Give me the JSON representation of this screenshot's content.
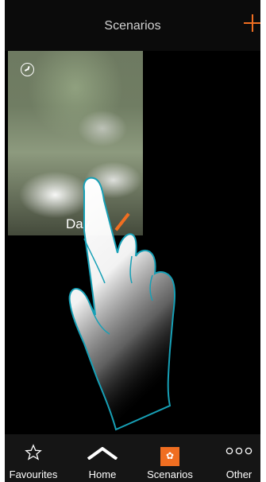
{
  "header": {
    "title": "Scenarios",
    "add_icon": "plus-icon"
  },
  "scenarios": [
    {
      "label": "Day",
      "icon": "clock-icon",
      "edit_icon": "pencil-icon"
    }
  ],
  "nav": {
    "items": [
      {
        "label": "Favourites",
        "icon": "star-icon",
        "active": false
      },
      {
        "label": "Home",
        "icon": "home-icon",
        "active": false
      },
      {
        "label": "Scenarios",
        "icon": "scenario-icon",
        "active": true
      },
      {
        "label": "Other",
        "icon": "more-icon",
        "active": false
      }
    ]
  },
  "colors": {
    "accent": "#f06e21",
    "background": "#0a0a0a",
    "nav_background": "#151515",
    "text": "#ffffff"
  }
}
